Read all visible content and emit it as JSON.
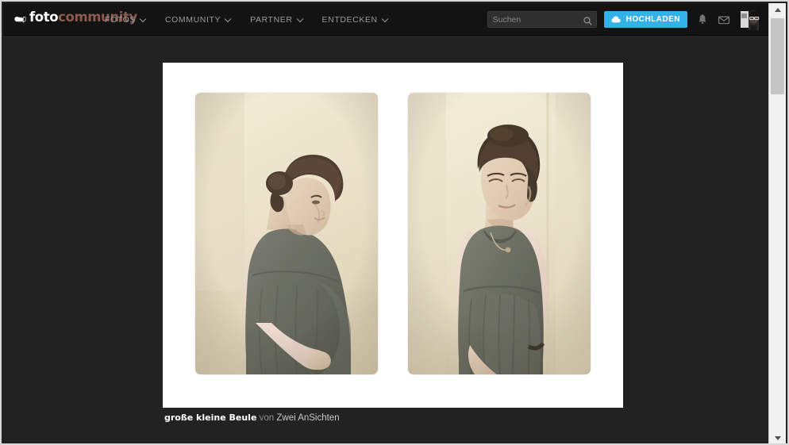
{
  "header": {
    "logo": {
      "icon": "camera-icon",
      "part1": "foto",
      "part2": "community",
      "accent_color": "#8d5a4e"
    },
    "nav": [
      {
        "label": "FOTOS",
        "caret": "chevron-down-icon"
      },
      {
        "label": "COMMUNITY",
        "caret": "chevron-down-icon"
      },
      {
        "label": "PARTNER",
        "caret": "chevron-down-icon"
      },
      {
        "label": "ENTDECKEN",
        "caret": "chevron-down-icon"
      }
    ],
    "search": {
      "placeholder": "Suchen",
      "value": "",
      "icon": "search-icon"
    },
    "upload": {
      "label": "HOCHLADEN",
      "icon": "cloud-upload-icon",
      "color": "#33b1e8"
    },
    "icons": [
      {
        "name": "bell-icon",
        "title": "Benachrichtigungen"
      },
      {
        "name": "envelope-icon",
        "title": "Nachrichten"
      }
    ],
    "avatar": {
      "name": "user-avatar",
      "alt": "Benutzerprofil"
    },
    "background_color": "#131313"
  },
  "main": {
    "background_color": "#222222",
    "panel_color": "#ffffff",
    "photos": [
      {
        "alt": "Schwangere Frau im Profil mit Pferdeschwanz, Hand am Bauch",
        "position": "left"
      },
      {
        "alt": "Schwangere Frau frontal, Blick nach unten, Hand am Bauch",
        "position": "right"
      }
    ],
    "caption": {
      "title": "große kleine Beule",
      "by": "von",
      "author": "Zwei AnSichten"
    }
  },
  "scrollbar": {
    "up_icon": "scroll-up-arrow-icon",
    "down_icon": "scroll-down-arrow-icon",
    "thumb": "scrollbar-thumb"
  }
}
